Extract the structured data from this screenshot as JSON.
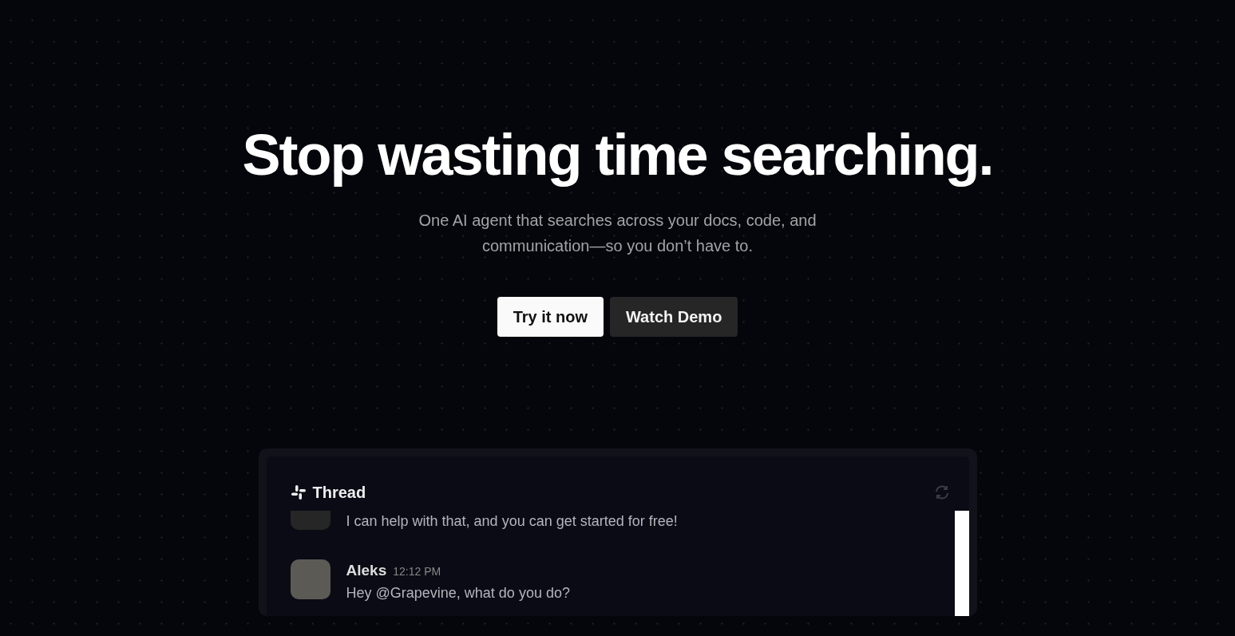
{
  "hero": {
    "title": "Stop wasting time searching.",
    "subtitle": "One AI agent that searches across your docs, code, and communication—so you don’t have to.",
    "buttons": [
      {
        "label": "Try it now",
        "kind": "primary"
      },
      {
        "label": "Watch Demo",
        "kind": "secondary"
      }
    ]
  },
  "thread": {
    "title": "Thread",
    "messages": [
      {
        "text": "I can help with that, and you can get started for free!",
        "kind": "bot"
      },
      {
        "author": "Aleks",
        "time": "12:12 PM",
        "text": "Hey @Grapevine, what do you do?",
        "kind": "human"
      }
    ]
  }
}
